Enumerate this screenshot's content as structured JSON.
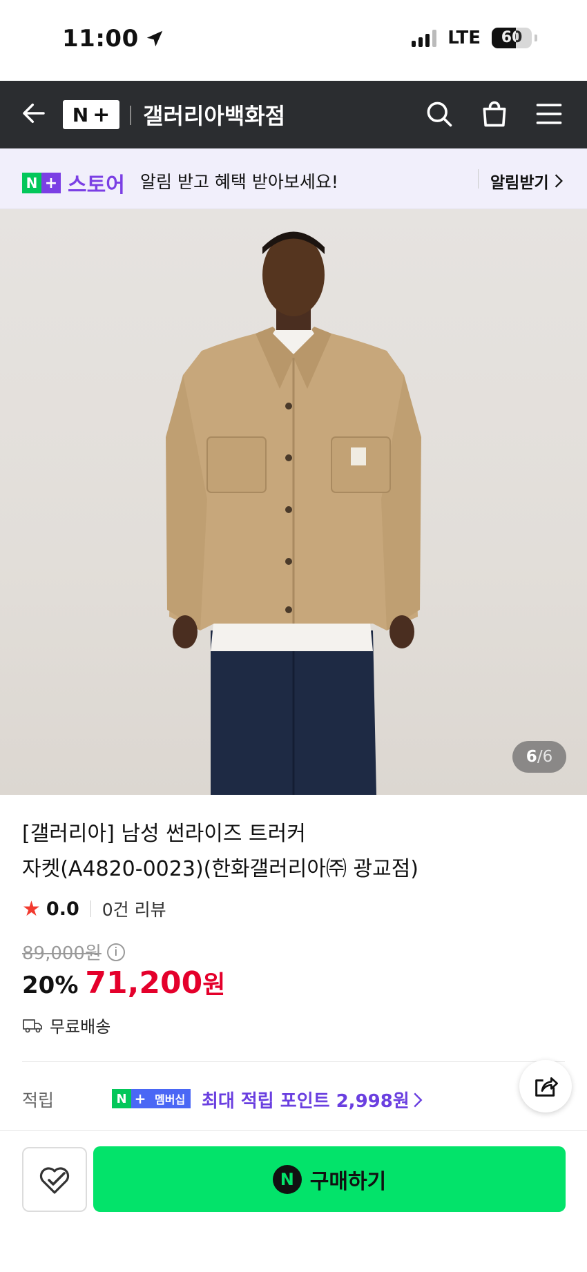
{
  "status_bar": {
    "time": "11:00",
    "network": "LTE",
    "battery": "60",
    "battery_level": 0.6
  },
  "header": {
    "logo_letter": "N",
    "logo_plus": "+",
    "title": "갤러리아백화점"
  },
  "banner": {
    "store_letter": "N",
    "store_plus": "+",
    "store_word": "스토어",
    "text": "알림 받고 혜택 받아보세요!",
    "action": "알림받기"
  },
  "gallery": {
    "current": "6",
    "separator": "/",
    "total": "6"
  },
  "product": {
    "title_line1": "[갤러리아] 남성 썬라이즈 트러커",
    "title_line2": "자켓(A4820-0023)(한화갤러리아㈜ 광교점)",
    "rating": "0.0",
    "reviews": "0건 리뷰",
    "original_price": "89,000원",
    "discount": "20%",
    "price": "71,200",
    "price_unit": "원",
    "shipping": "무료배송"
  },
  "points": {
    "label": "적립",
    "badge_letter": "N",
    "badge_plus": "+",
    "badge_text": "멤버십",
    "text": "최대 적립 포인트 2,998원"
  },
  "bottom": {
    "buy_icon_letter": "N",
    "buy_label": "구매하기"
  },
  "colors": {
    "header_bg": "#2b2d30",
    "naver_green": "#03c75a",
    "buy_green": "#03e36a",
    "purple": "#7b3fe4",
    "price_red": "#e4002b"
  }
}
